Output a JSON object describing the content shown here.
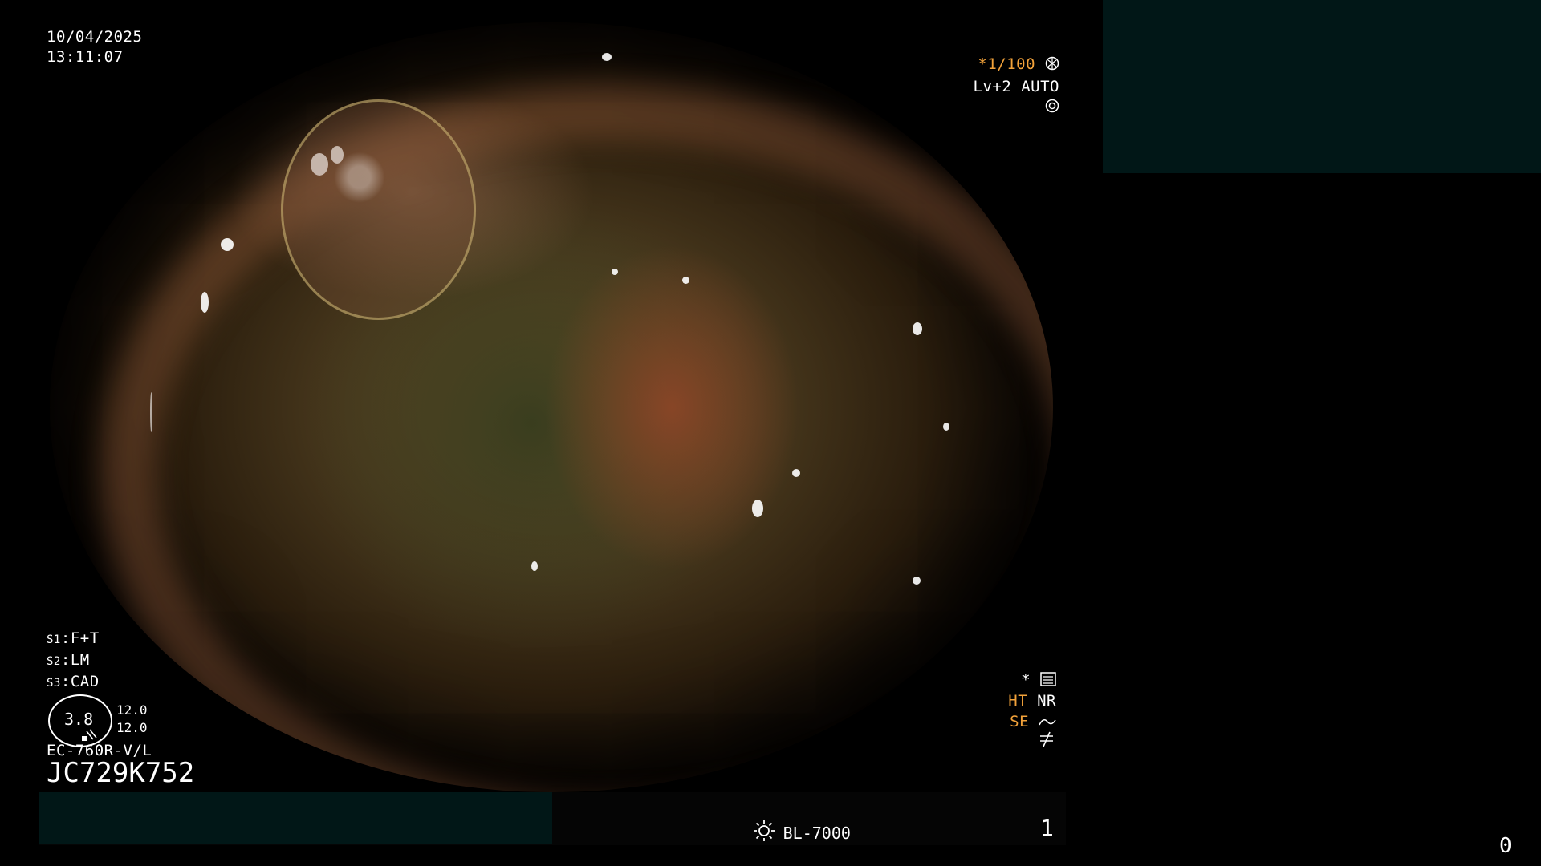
{
  "datetime": {
    "date": "10/04/2025",
    "time": "13:11:07"
  },
  "top_right": {
    "shutter": "*1/100",
    "level": "Lv+2",
    "mode": "AUTO"
  },
  "switches": [
    {
      "key": "S1",
      "value": "F+T"
    },
    {
      "key": "S2",
      "value": "LM"
    },
    {
      "key": "S3",
      "value": "CAD"
    }
  ],
  "gauge": {
    "value": "3.8",
    "line1": "12.0",
    "line2": "12.0"
  },
  "scope_model": "EC-760R-V/L",
  "serial": "JC729K752",
  "bottom_right_indicators": {
    "star": "*",
    "ht": "HT",
    "nr": "NR",
    "se": "SE"
  },
  "light_source": "BL-7000",
  "frame_number": "1",
  "corner_number": "0",
  "colors": {
    "orange": "#f2a23a",
    "panel": "#011717"
  }
}
